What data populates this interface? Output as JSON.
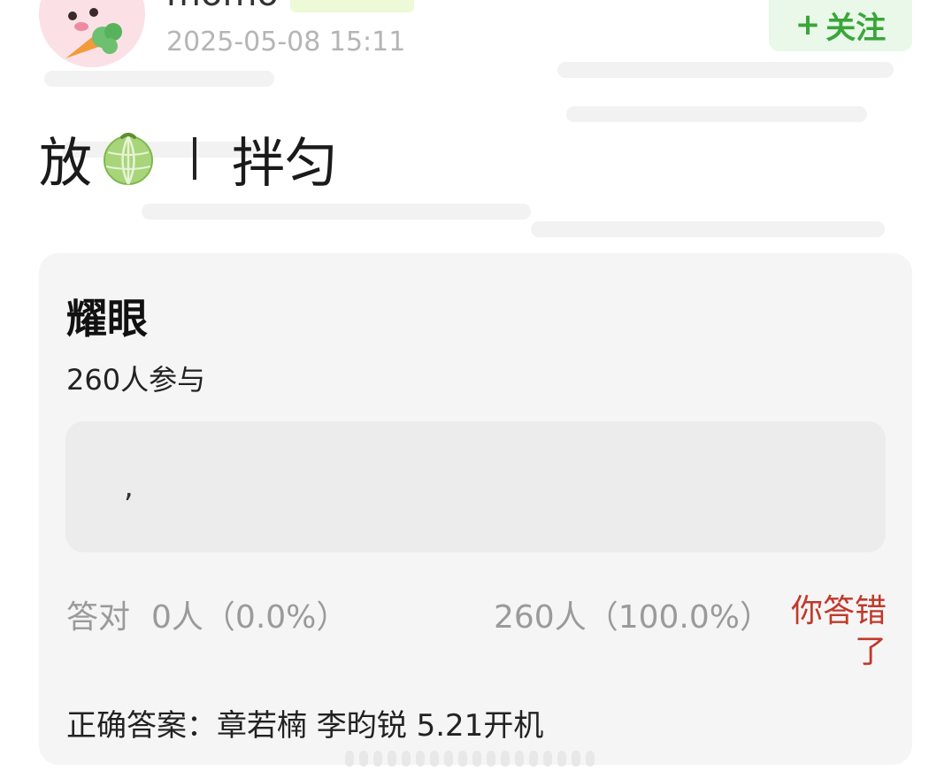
{
  "header": {
    "username": "momo",
    "timestamp": "2025-05-08 15:11",
    "follow_plus": "+",
    "follow_label": "关注"
  },
  "post": {
    "title_prefix": "放",
    "title_emoji": "melon-icon",
    "title_suffix": "拌匀"
  },
  "quiz": {
    "title": "耀眼",
    "participants": "260人参与",
    "answer_text": ",",
    "correct_label": "答对",
    "correct_stat": "0人（0.0%）",
    "wrong_stat": "260人（100.0%）",
    "result": "你答错了",
    "answer_line": "正确答案：章若楠 李昀锐 5.21开机"
  },
  "colors": {
    "follow_bg": "#e9f8e9",
    "follow_text": "#3aa63a",
    "wrong_text": "#c0392b",
    "card_bg": "#f5f5f5"
  }
}
